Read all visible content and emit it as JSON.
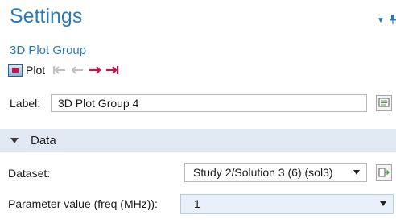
{
  "header": {
    "title": "Settings",
    "subtitle": "3D Plot Group"
  },
  "toolbar": {
    "plot_label": "Plot",
    "nav_icons": [
      "first-icon",
      "previous-icon",
      "next-icon",
      "last-icon"
    ]
  },
  "label_field": {
    "label": "Label:",
    "value": "3D Plot Group 4"
  },
  "section": {
    "label": "Data"
  },
  "dataset": {
    "label": "Dataset:",
    "value": "Study 2/Solution 3 (6) (sol3)"
  },
  "parameter": {
    "label": "Parameter value (freq (MHz)):",
    "value": "1"
  },
  "colors": {
    "accent": "#2a7ab8",
    "section_bg": "#dfe8f3",
    "highlight_field": "#e8f1fb",
    "nav_active": "#c0184b"
  }
}
